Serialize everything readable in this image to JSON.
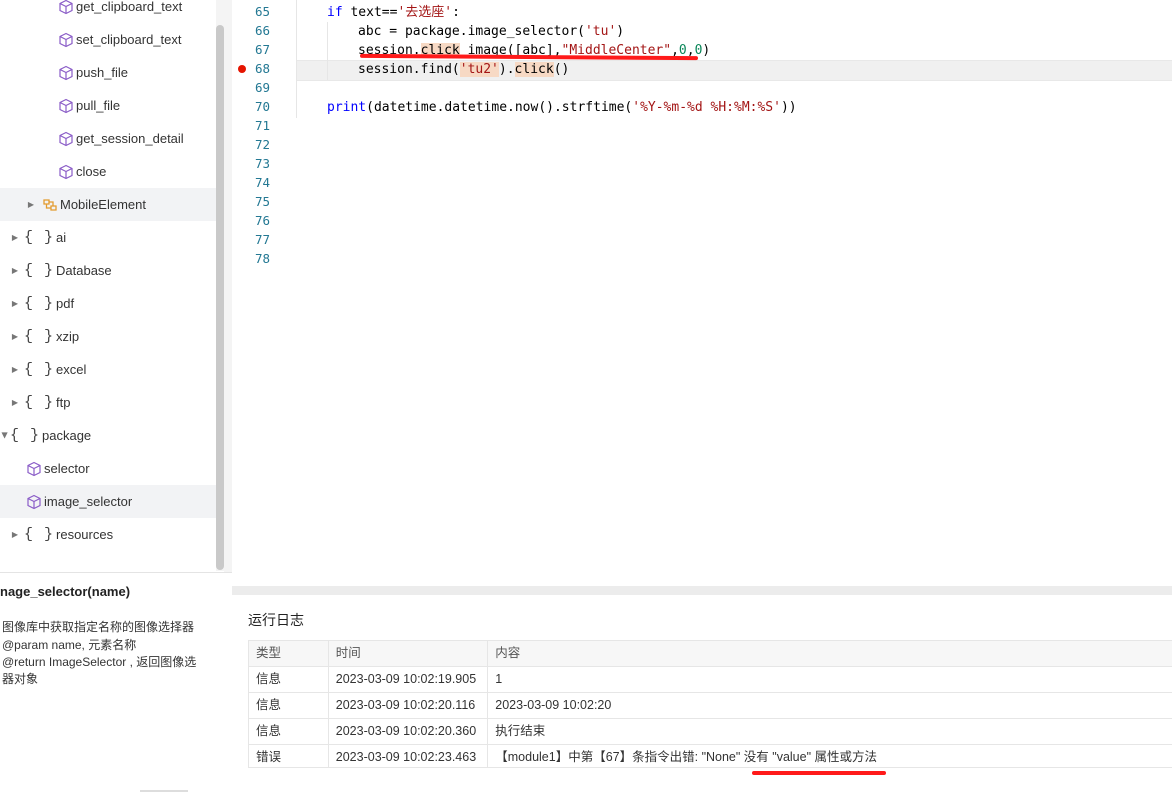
{
  "tree": {
    "items": [
      {
        "label": "get_clipboard_text",
        "kind": "method"
      },
      {
        "label": "set_clipboard_text",
        "kind": "method"
      },
      {
        "label": "push_file",
        "kind": "method"
      },
      {
        "label": "pull_file",
        "kind": "method"
      },
      {
        "label": "get_session_detail",
        "kind": "method"
      },
      {
        "label": "close",
        "kind": "method"
      },
      {
        "label": "MobileElement",
        "kind": "class"
      },
      {
        "label": "ai",
        "kind": "module"
      },
      {
        "label": "Database",
        "kind": "module"
      },
      {
        "label": "pdf",
        "kind": "module"
      },
      {
        "label": "xzip",
        "kind": "module"
      },
      {
        "label": "excel",
        "kind": "module"
      },
      {
        "label": "ftp",
        "kind": "module"
      },
      {
        "label": "package",
        "kind": "module"
      },
      {
        "label": "selector",
        "kind": "method"
      },
      {
        "label": "image_selector",
        "kind": "method"
      },
      {
        "label": "resources",
        "kind": "module"
      }
    ]
  },
  "doc": {
    "title": "nage_selector(name)",
    "lines": [
      "图像库中获取指定名称的图像选择器",
      "@param name, 元素名称",
      "@return  ImageSelector , 返回图像选",
      "器对象"
    ]
  },
  "editor": {
    "line_numbers": [
      "65",
      "66",
      "67",
      "68",
      "69",
      "70",
      "71",
      "72",
      "73",
      "74",
      "75",
      "76",
      "77",
      "78"
    ],
    "code": {
      "l65_kw": "if",
      "l65_a": " text==",
      "l65_str": "'去选座'",
      "l65_b": ":",
      "l66_a": "abc = package.image_selector(",
      "l66_str": "'tu'",
      "l66_b": ")",
      "l67_a": "session.",
      "l67_hl": "click",
      "l67_b": "_image([abc],",
      "l67_str": "\"MiddleCenter\"",
      "l67_c": ",",
      "l67_n1": "0",
      "l67_d": ",",
      "l67_n2": "0",
      "l67_e": ")",
      "l68_a": "session.find(",
      "l68_str": "'tu2'",
      "l68_b": ").",
      "l68_hl": "click",
      "l68_c": "()",
      "l70_kw": "print",
      "l70_a": "(datetime.datetime.now().strftime(",
      "l70_str": "'%Y-%m-%d %H:%M:%S'",
      "l70_b": "))"
    },
    "breakpoint_line": "68"
  },
  "log": {
    "title": "运行日志",
    "columns": [
      "类型",
      "时间",
      "内容"
    ],
    "rows": [
      {
        "type": "信息",
        "time": "2023-03-09 10:02:19.905",
        "content": "1"
      },
      {
        "type": "信息",
        "time": "2023-03-09 10:02:20.116",
        "content": "2023-03-09 10:02:20"
      },
      {
        "type": "信息",
        "time": "2023-03-09 10:02:20.360",
        "content": "执行结束"
      },
      {
        "type": "错误",
        "time": "2023-03-09 10:02:23.463",
        "content": "【module1】中第【67】条指令出错: \"None\" 没有 \"value\" 属性或方法"
      }
    ]
  },
  "colors": {
    "keyword": "#0000ff",
    "string": "#a31515",
    "number": "#098658",
    "line_number": "#237893",
    "breakpoint": "#e51400",
    "annotation_red": "#ff1a1a",
    "method_icon": "#8a5cc7",
    "class_icon": "#e39b2f"
  }
}
